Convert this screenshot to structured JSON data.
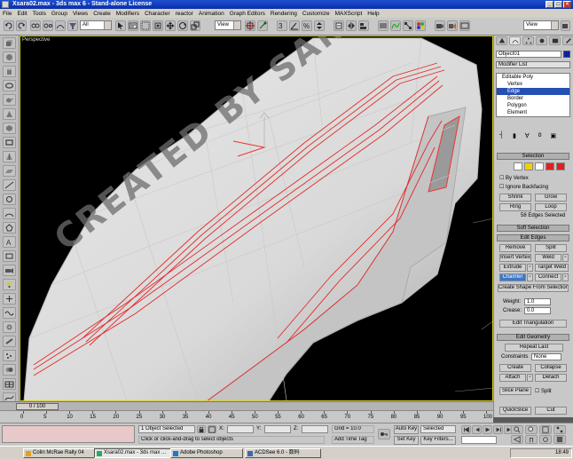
{
  "window": {
    "title": "Xsara02.max - 3ds max 6 - Stand-alone License"
  },
  "menu": [
    "File",
    "Edit",
    "Tools",
    "Group",
    "Views",
    "Create",
    "Modifiers",
    "Character",
    "reactor",
    "Animation",
    "Graph Editors",
    "Rendering",
    "Customize",
    "MAXScript",
    "Help"
  ],
  "toolbar": {
    "filter_value": "All",
    "ref_coord_value": "View",
    "named_sel_value": "View"
  },
  "viewport": {
    "label": "Perspective",
    "watermark": "CREATED BY SANSHI"
  },
  "command_panel": {
    "object_name": "Object01",
    "modifier_list": "Modifier List",
    "stack": [
      "Editable Poly",
      "Vertex",
      "Edge",
      "Border",
      "Polygon",
      "Element"
    ],
    "stack_selected": "Edge",
    "selection": {
      "header": "Selection",
      "by_vertex": "By Vertex",
      "ignore_backfacing": "Ignore Backfacing",
      "shrink": "Shrink",
      "grow": "Grow",
      "ring": "Ring",
      "loop": "Loop",
      "status": "58 Edges Selected"
    },
    "soft_selection": "Soft Selection",
    "edit_edges": {
      "header": "Edit Edges",
      "remove": "Remove",
      "split": "Split",
      "insert_vertex": "Insert Vertex",
      "weld": "Weld",
      "extrude": "Extrude",
      "target_weld": "Target Weld",
      "chamfer": "Chamfer",
      "connect": "Connect",
      "create_shape": "Create Shape From Selection",
      "weight_label": "Weight:",
      "weight_value": "1.0",
      "crease_label": "Crease:",
      "crease_value": "0.0",
      "edit_triangulation": "Edit Triangulation"
    },
    "edit_geometry": {
      "header": "Edit Geometry",
      "repeat_last": "Repeat Last",
      "constraints_label": "Constraints",
      "constraints_value": "None",
      "create": "Create",
      "collapse": "Collapse",
      "attach": "Attach",
      "detach": "Detach",
      "slice_plane": "Slice Plane",
      "split": "Split",
      "quickslice": "QuickSlice",
      "cut": "Cut"
    }
  },
  "timeline": {
    "slider": "0 / 100",
    "ticks": [
      "0",
      "5",
      "10",
      "15",
      "20",
      "25",
      "30",
      "35",
      "40",
      "45",
      "50",
      "55",
      "60",
      "65",
      "70",
      "75",
      "80",
      "85",
      "90",
      "95",
      "100"
    ]
  },
  "status": {
    "selected": "1 Object Selected",
    "prompt": "Click or click-and-drag to select objects",
    "x_label": "X:",
    "y_label": "Y:",
    "z_label": "Z:",
    "grid": "Grid = 10.0",
    "add_time_tag": "Add Time Tag",
    "auto_key": "Auto Key",
    "set_key": "Set Key",
    "key_mode_value": "Selected",
    "key_filters": "Key Filters..."
  },
  "taskbar": {
    "tasks": [
      "Colin McRae Rally 04",
      "Xsara02.max - 3ds max ...",
      "Adobe Photoshop",
      "ACDSee 6.0 - 数码"
    ],
    "time": "18:49"
  }
}
